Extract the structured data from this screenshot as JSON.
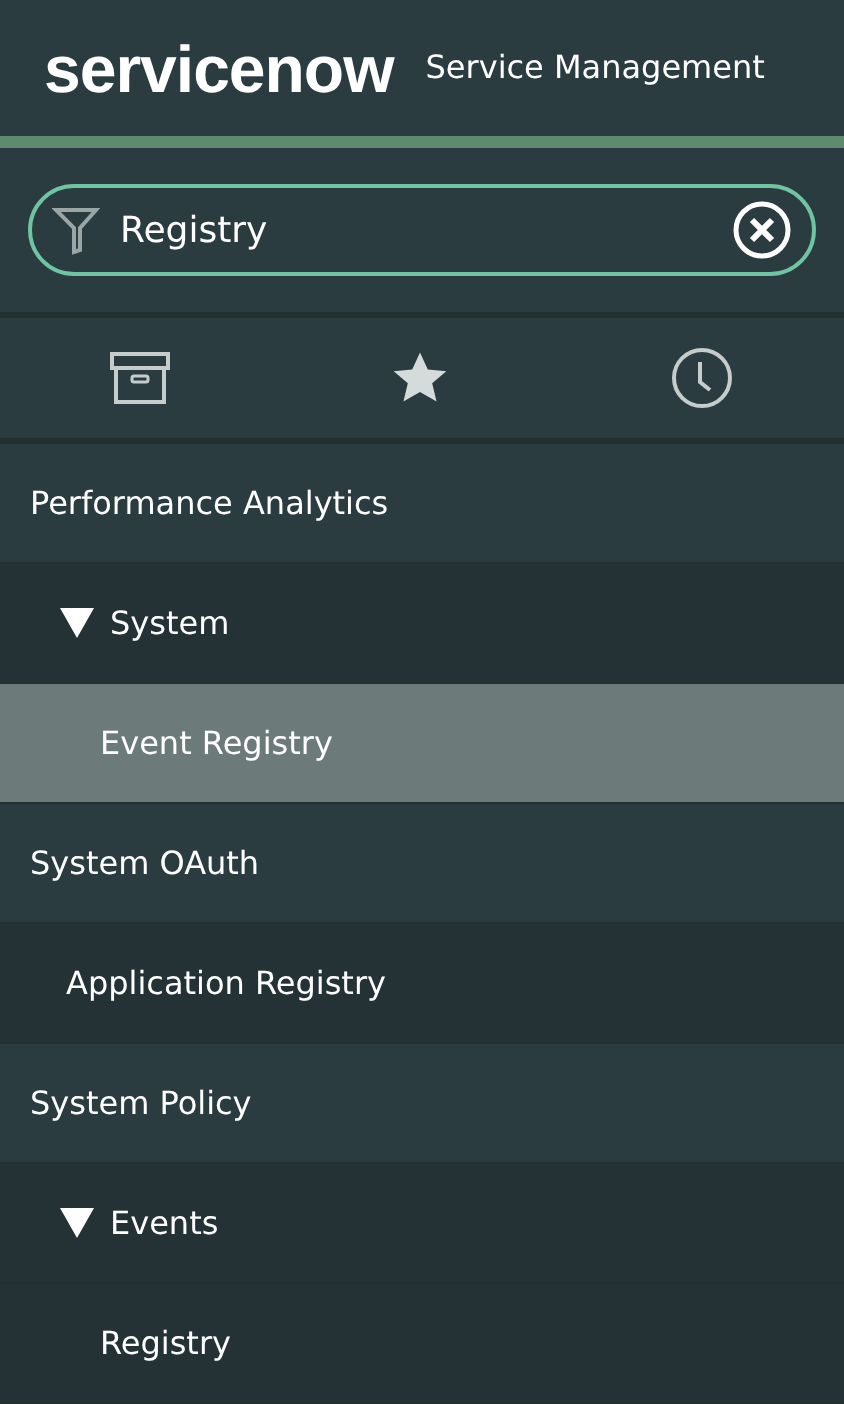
{
  "header": {
    "logo": "servicenow",
    "title": "Service Management"
  },
  "filter": {
    "value": "Registry"
  },
  "nav": [
    {
      "kind": "application",
      "label": "Performance Analytics",
      "children": [
        {
          "kind": "module",
          "label": "System",
          "expanded": true,
          "children": [
            {
              "kind": "link",
              "label": "Event Registry",
              "selected": true
            }
          ]
        }
      ]
    },
    {
      "kind": "application",
      "label": "System OAuth",
      "children": [
        {
          "kind": "link",
          "label": "Application Registry",
          "selected": false
        }
      ]
    },
    {
      "kind": "application",
      "label": "System Policy",
      "children": [
        {
          "kind": "module",
          "label": "Events",
          "expanded": true,
          "children": [
            {
              "kind": "link",
              "label": "Registry",
              "selected": false
            }
          ]
        }
      ]
    }
  ]
}
